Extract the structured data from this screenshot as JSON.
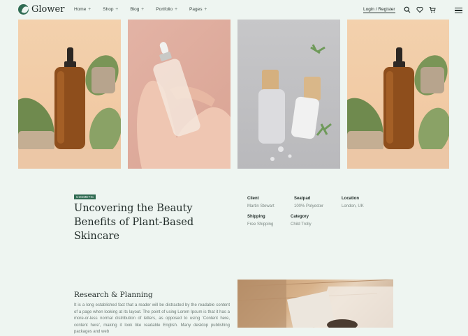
{
  "header": {
    "brand": "Glower",
    "nav": [
      {
        "label": "Home",
        "plus": "+"
      },
      {
        "label": "Shop",
        "plus": "+"
      },
      {
        "label": "Blog",
        "plus": "+"
      },
      {
        "label": "Portfolio",
        "plus": "+"
      },
      {
        "label": "Pages",
        "plus": "+"
      }
    ],
    "login": "Login / Register",
    "icons": [
      "search-icon",
      "heart-icon",
      "cart-icon",
      "menu-icon"
    ]
  },
  "gallery": {
    "images": [
      "amber dropper bottle with leaves",
      "hand holding clear dropper bottle",
      "two frosted bottles with wooden caps",
      "amber dropper bottle with leaves"
    ]
  },
  "project": {
    "category": "COSMETIC",
    "title": "Uncovering the Beauty Benefits of Plant-Based Skincare",
    "meta": [
      {
        "key": "Client",
        "value": "Martin Stewart"
      },
      {
        "key": "Seatpad",
        "value": "100% Polyester"
      },
      {
        "key": "Location",
        "value": "London, UK"
      },
      {
        "key": "Shipping",
        "value": "Free Shipping"
      },
      {
        "key": "Category",
        "value": "Child Trolly"
      }
    ]
  },
  "research": {
    "title": "Research & Planning",
    "text": "It is a long established fact that a reader will be distracted by the readable content of a page when looking at its layout. The point of using Lorem Ipsum is that it has a more-or-less normal distribution of letters, as opposed to using 'Content here, content here', making it look like readable English. Many desktop publishing packages and web"
  },
  "colors": {
    "accent": "#2f6b52",
    "background": "#eef5f1"
  }
}
